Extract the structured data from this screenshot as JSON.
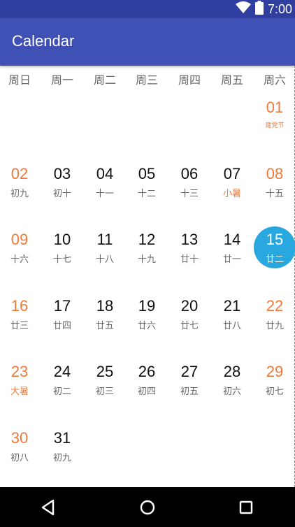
{
  "status_bar": {
    "time": "7:00"
  },
  "app_bar": {
    "title": "Calendar"
  },
  "weekdays": [
    "周日",
    "周一",
    "周二",
    "周三",
    "周四",
    "周五",
    "周六"
  ],
  "calendar": {
    "weeks": [
      [
        null,
        null,
        null,
        null,
        null,
        null,
        {
          "day": "01",
          "lunar": "建党节",
          "weekend": true,
          "festival": true
        }
      ],
      [
        {
          "day": "02",
          "lunar": "初九",
          "weekend": true
        },
        {
          "day": "03",
          "lunar": "初十"
        },
        {
          "day": "04",
          "lunar": "十一"
        },
        {
          "day": "05",
          "lunar": "十二"
        },
        {
          "day": "06",
          "lunar": "十三"
        },
        {
          "day": "07",
          "lunar": "小暑",
          "festival": true
        },
        {
          "day": "08",
          "lunar": "十五",
          "weekend": true
        }
      ],
      [
        {
          "day": "09",
          "lunar": "十六",
          "weekend": true
        },
        {
          "day": "10",
          "lunar": "十七"
        },
        {
          "day": "11",
          "lunar": "十八"
        },
        {
          "day": "12",
          "lunar": "十九"
        },
        {
          "day": "13",
          "lunar": "廿十"
        },
        {
          "day": "14",
          "lunar": "廿一"
        },
        {
          "day": "15",
          "lunar": "廿二",
          "weekend": true,
          "selected": true
        }
      ],
      [
        {
          "day": "16",
          "lunar": "廿三",
          "weekend": true
        },
        {
          "day": "17",
          "lunar": "廿四"
        },
        {
          "day": "18",
          "lunar": "廿五"
        },
        {
          "day": "19",
          "lunar": "廿六"
        },
        {
          "day": "20",
          "lunar": "廿七"
        },
        {
          "day": "21",
          "lunar": "廿八"
        },
        {
          "day": "22",
          "lunar": "廿九",
          "weekend": true
        }
      ],
      [
        {
          "day": "23",
          "lunar": "大暑",
          "weekend": true,
          "festival": true
        },
        {
          "day": "24",
          "lunar": "初二"
        },
        {
          "day": "25",
          "lunar": "初三"
        },
        {
          "day": "26",
          "lunar": "初四"
        },
        {
          "day": "27",
          "lunar": "初五"
        },
        {
          "day": "28",
          "lunar": "初六"
        },
        {
          "day": "29",
          "lunar": "初七",
          "weekend": true
        }
      ],
      [
        {
          "day": "30",
          "lunar": "初八",
          "weekend": true
        },
        {
          "day": "31",
          "lunar": "初九"
        },
        null,
        null,
        null,
        null,
        null
      ]
    ]
  },
  "nav_bar": {
    "buttons": [
      "back",
      "home",
      "recents"
    ]
  },
  "colors": {
    "app_bar": "#3f51b5",
    "status_bar": "#303f9f",
    "weekend_accent": "#f07a3a",
    "selected": "#29a8e0"
  }
}
